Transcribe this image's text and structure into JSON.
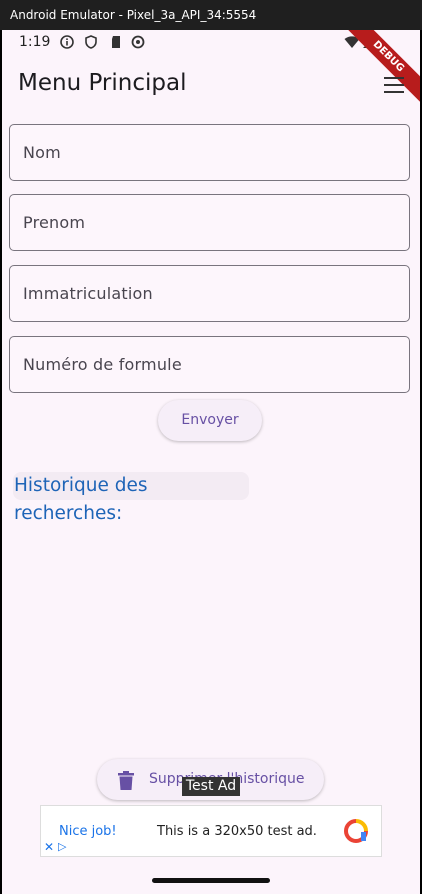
{
  "window": {
    "title": "Android Emulator - Pixel_3a_API_34:5554"
  },
  "status_bar": {
    "time": "1:19",
    "debug_banner": "DEBUG"
  },
  "app_bar": {
    "title": "Menu Principal"
  },
  "form": {
    "fields": [
      {
        "label": "Nom"
      },
      {
        "label": "Prenom"
      },
      {
        "label": "Immatriculation"
      },
      {
        "label": "Numéro de formule"
      }
    ],
    "submit_label": "Envoyer"
  },
  "history": {
    "title": "Historique des recherches:"
  },
  "clear_history": {
    "label": "Supprimer l'historique"
  },
  "ad": {
    "tag": "Test Ad",
    "headline": "Nice job!",
    "description": "This is a 320x50 test ad."
  },
  "colors": {
    "primary": "#6750a4",
    "history_text": "#1e64b7",
    "screen_bg": "#fcf4fb"
  }
}
